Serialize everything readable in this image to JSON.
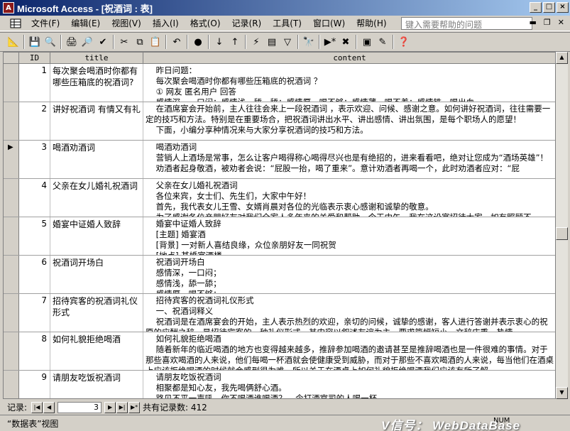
{
  "window": {
    "title": "Microsoft Access - [祝酒词 : 表]"
  },
  "menu": {
    "items": [
      "文件(F)",
      "编辑(E)",
      "视图(V)",
      "插入(I)",
      "格式(O)",
      "记录(R)",
      "工具(T)",
      "窗口(W)",
      "帮助(H)"
    ],
    "help_placeholder": "键入需要帮助的问题"
  },
  "table": {
    "headers": {
      "id": "ID",
      "title": "title",
      "content": "content"
    },
    "current_row": 3,
    "rows": [
      {
        "id": "1",
        "title": "每次聚会喝酒时你都有哪些压箱底的祝酒词?",
        "content": "    昨日问题：\n    每次聚会喝酒时你都有哪些压箱底的祝酒词 ？\n    ① 网友 匿名用户 回答\n    感情深，一口闷；感情浅，舔一舔；感情厚，喝不够；感情薄，喝不着；感情铁，喝出血。"
      },
      {
        "id": "2",
        "title": "讲好祝酒词 有情又有礼",
        "content": "    在酒席宴会开始前，主人往往会来上一段祝酒词 ，表示欢迎、问候、感谢之意。如何讲好祝酒词，往往需要一定的技巧和方法。特别是在重要场合，把祝酒词讲出水平、讲出感情、讲出氛围，是每个职场人的愿望！\n    下面，小编分享种情况来与大家分享祝酒词的技巧和方法。"
      },
      {
        "id": "3",
        "title": "喝酒劝酒词",
        "content": "    喝酒劝酒词\n    营销人上酒场是常事，怎么让客户喝得称心喝得尽兴也是有绝招的，进来看看吧，绝对让您成为“酒场英雄”！\n    劝酒者起身敬酒，被劝者会说：“屁股一抬，喝了重来”。意计劝酒者再喝一个，此时劝酒者应对：“屁"
      },
      {
        "id": "4",
        "title": "父亲在女儿婚礼祝酒词",
        "content": "    父亲在女儿婚礼祝酒词\n    各位来宾，女士们、先生们，大家中午好！\n    首先，我代表女儿王雪、女婿肖晨对各位的光临表示衷心感谢和诚挚的敬意。\n    为了感谢各位亲朋好友对我们全家人多年来的关爱和帮助，今天中午，我在这设宴招待大家，如有照顾不"
      },
      {
        "id": "5",
        "title": "婚宴中证婚人致辞",
        "content": "    婚宴中证婚人致辞\n    [主题] 婚宴酒\n    [背景] 一对新人喜结良缘，众位亲朋好友一同祝贺\n    [地点] 某婚宴酒楼"
      },
      {
        "id": "6",
        "title": "祝酒词开场白",
        "content": "    祝酒词开场白\n    感情深，一口闷；\n    感情浅，舔一舔；\n    感情厚，喝不够；"
      },
      {
        "id": "7",
        "title": "招待宾客的祝酒词礼仪形式",
        "content": "    招待宾客的祝酒词礼仪形式\n    一、祝酒词释义\n    祝酒词是在酒席宴会的开始，主人表示热烈的欢迎，亲切的问候，诚挚的感谢，客人进行答谢并表示衷心的祝愿的应酬之辞，是招待宾客的一种礼仪形式。其内容以叙述友谊为主，要求篇幅短小，文辞庄重、热情"
      },
      {
        "id": "8",
        "title": "如何礼貌拒绝喝酒",
        "content": "    如何礼貌拒绝喝酒\n    随着新年的临近喝酒的地方也变得越来越多，推辞参加喝酒的邀请甚至是推辞喝酒也是一件很难的事情。对于那些喜欢喝酒的人来说，他们每喝一杯酒就会使健康受到威胁，而对于那些不喜欢喝酒的人来说，每当他们在酒桌上应该拒绝喝酒的时候就会感到很为难，所以关于在酒桌上如何礼貌拒绝喝酒我们应该有所了解。"
      },
      {
        "id": "9",
        "title": "请朋友吃饭祝酒词",
        "content": "    请朋友吃饭祝酒词\n    相聚都是知心友，我先喝俩舒心酒。\n    路见不平一声吼，你不喝酒谁喝酒？---令打酒官司的人喝一杯"
      }
    ]
  },
  "navigator": {
    "label": "记录:",
    "current": "3",
    "total_label": "共有记录数: 412"
  },
  "status": {
    "text": "“数据表”视图",
    "mode": "NUM",
    "watermark": "V信号：  WebDataBase"
  }
}
